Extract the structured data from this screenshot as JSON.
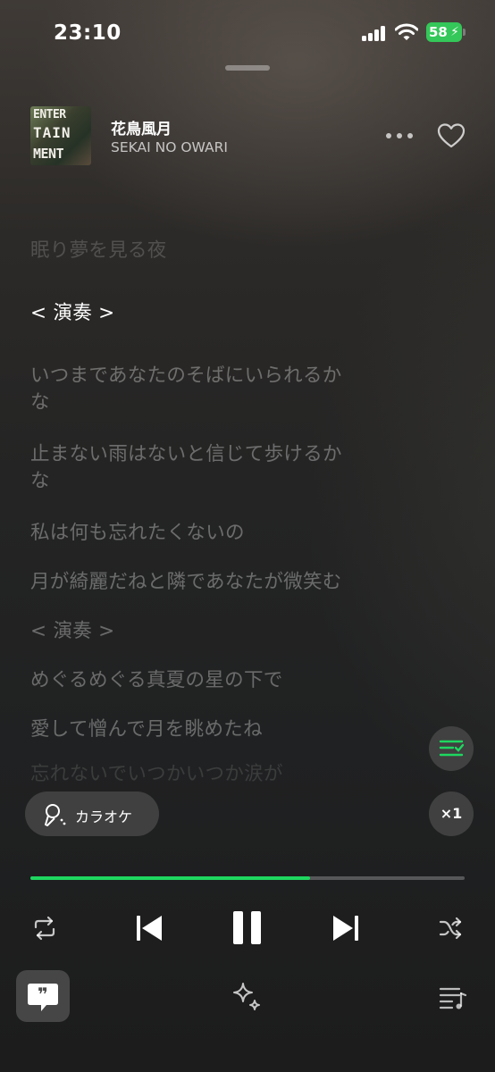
{
  "status_bar": {
    "time": "23:10",
    "battery": "58",
    "battery_color": "#34c759"
  },
  "now_playing": {
    "album_art_words": [
      "ENTER",
      "TAIN",
      "MENT"
    ],
    "title": "花鳥風月",
    "artist": "SEKAI NO OWARI",
    "liked": false
  },
  "lyrics": {
    "lines": [
      {
        "text": "眠り夢を見る夜",
        "state": "past"
      },
      {
        "text": "< 演奏 >",
        "state": "current"
      },
      {
        "text": "いつまであなたのそばにいられるか",
        "state": "upcoming"
      },
      {
        "text": "な",
        "state": "upcoming"
      },
      {
        "text": "止まない雨はないと信じて歩けるか",
        "state": "upcoming"
      },
      {
        "text": "な",
        "state": "upcoming"
      },
      {
        "text": "私は何も忘れたくないの",
        "state": "upcoming"
      },
      {
        "text": "月が綺麗だねと隣であなたが微笑む",
        "state": "upcoming"
      },
      {
        "text": "< 演奏 >",
        "state": "upcoming"
      },
      {
        "text": "めぐるめぐる真夏の星の下で",
        "state": "upcoming"
      },
      {
        "text": "愛して憎んで月を眺めたね",
        "state": "upcoming"
      },
      {
        "text": "忘れないでいつかいつか涙が",
        "state": "faded"
      }
    ]
  },
  "karaoke": {
    "label": "カラオケ",
    "icon": "microphone-icon"
  },
  "speed": {
    "label": "×1"
  },
  "progress": {
    "fraction": 0.645,
    "color": "#1ed760"
  },
  "controls": {
    "repeat_icon": "repeat-icon",
    "previous_icon": "skip-previous-icon",
    "play_pause_icon": "pause-icon",
    "next_icon": "skip-next-icon",
    "shuffle_icon": "shuffle-icon"
  },
  "bottom_bar": {
    "left_icon": "lyrics-quote-icon",
    "center_icon": "sparkle-icon",
    "right_icon": "queue-icon"
  },
  "accent_color": "#1ed760"
}
